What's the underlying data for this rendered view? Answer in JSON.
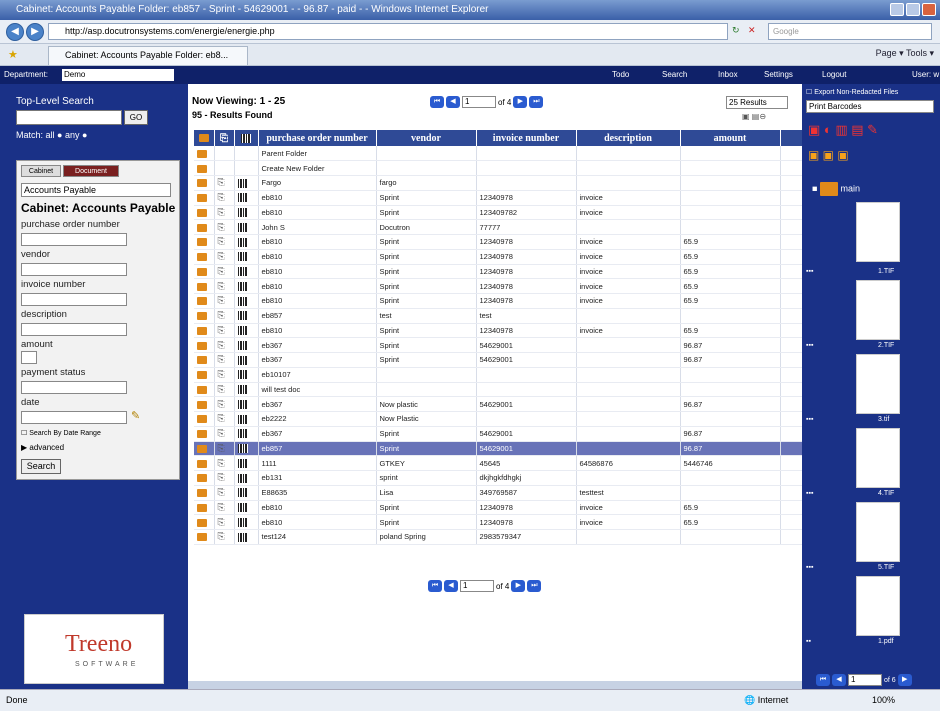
{
  "window": {
    "title": "Cabinet: Accounts Payable Folder: eb857 - Sprint - 54629001 - - 96.87 - paid - - Windows Internet Explorer"
  },
  "browser": {
    "url": "http://asp.docutronsystems.com/energie/energie.php",
    "search_placeholder": "Google",
    "tab_title": "Cabinet: Accounts Payable Folder: eb8...",
    "tools": "Page ▾  Tools ▾"
  },
  "appbar": {
    "department_label": "Department:",
    "department_value": "Demo",
    "nav": [
      "Todo",
      "Search",
      "Inbox",
      "Settings",
      "Logout",
      "User: w"
    ]
  },
  "sidebar": {
    "top_search_label": "Top-Level Search",
    "go": "GO",
    "match_label": "Match:",
    "match_all": "all",
    "match_any": "any",
    "tabs": [
      "Cabinet",
      "Document"
    ],
    "cabinet_select": "Accounts Payable",
    "cabinet_title": "Cabinet: Accounts Payable",
    "fields": [
      "purchase order number",
      "vendor",
      "invoice number",
      "description",
      "amount",
      "payment status",
      "date"
    ],
    "date_range": "Search By Date Range",
    "advanced": "advanced",
    "search_button": "Search",
    "logo_text": "Treeno",
    "logo_sub": "SOFTWARE"
  },
  "main": {
    "viewing": "Now Viewing: 1 - 25",
    "results": "95 - Results Found",
    "page_input": "1",
    "page_of": "of 4",
    "results_select": "25 Results",
    "columns": [
      "purchase order number",
      "vendor",
      "invoice number",
      "description",
      "amount"
    ],
    "rows": [
      {
        "po": "Parent Folder",
        "vendor": "",
        "inv": "",
        "desc": "",
        "amt": "",
        "kind": "parent"
      },
      {
        "po": "Create New Folder",
        "vendor": "",
        "inv": "",
        "desc": "",
        "amt": "",
        "kind": "new"
      },
      {
        "po": "Fargo",
        "vendor": "fargo",
        "inv": "",
        "desc": "",
        "amt": ""
      },
      {
        "po": "eb810",
        "vendor": "Sprint",
        "inv": "12340978",
        "desc": "invoice",
        "amt": ""
      },
      {
        "po": "eb810",
        "vendor": "Sprint",
        "inv": "123409782",
        "desc": "invoice",
        "amt": ""
      },
      {
        "po": "John S",
        "vendor": "Docutron",
        "inv": "77777",
        "desc": "",
        "amt": ""
      },
      {
        "po": "eb810",
        "vendor": "Sprint",
        "inv": "12340978",
        "desc": "invoice",
        "amt": "65.9"
      },
      {
        "po": "eb810",
        "vendor": "Sprint",
        "inv": "12340978",
        "desc": "invoice",
        "amt": "65.9"
      },
      {
        "po": "eb810",
        "vendor": "Sprint",
        "inv": "12340978",
        "desc": "invoice",
        "amt": "65.9"
      },
      {
        "po": "eb810",
        "vendor": "Sprint",
        "inv": "12340978",
        "desc": "invoice",
        "amt": "65.9"
      },
      {
        "po": "eb810",
        "vendor": "Sprint",
        "inv": "12340978",
        "desc": "invoice",
        "amt": "65.9"
      },
      {
        "po": "eb857",
        "vendor": "test",
        "inv": "test",
        "desc": "",
        "amt": ""
      },
      {
        "po": "eb810",
        "vendor": "Sprint",
        "inv": "12340978",
        "desc": "invoice",
        "amt": "65.9"
      },
      {
        "po": "eb367",
        "vendor": "Sprint",
        "inv": "54629001",
        "desc": "",
        "amt": "96.87"
      },
      {
        "po": "eb367",
        "vendor": "Sprint",
        "inv": "54629001",
        "desc": "",
        "amt": "96.87"
      },
      {
        "po": "eb10107",
        "vendor": "",
        "inv": "",
        "desc": "",
        "amt": ""
      },
      {
        "po": "will test doc",
        "vendor": "",
        "inv": "",
        "desc": "",
        "amt": ""
      },
      {
        "po": "eb367",
        "vendor": "Now plastic",
        "inv": "54629001",
        "desc": "",
        "amt": "96.87"
      },
      {
        "po": "eb2222",
        "vendor": "Now Plastic",
        "inv": "",
        "desc": "",
        "amt": ""
      },
      {
        "po": "eb367",
        "vendor": "Sprint",
        "inv": "54629001",
        "desc": "",
        "amt": "96.87"
      },
      {
        "po": "eb857",
        "vendor": "Sprint",
        "inv": "54629001",
        "desc": "",
        "amt": "96.87",
        "kind": "sel"
      },
      {
        "po": "1111",
        "vendor": "GTKEY",
        "inv": "45645",
        "desc": "64586876",
        "amt": "5446746"
      },
      {
        "po": "eb131",
        "vendor": "sprint",
        "inv": "dkjhgkfdhgkj",
        "desc": "",
        "amt": ""
      },
      {
        "po": "E88635",
        "vendor": "Lisa",
        "inv": "349769587",
        "desc": "testtest",
        "amt": ""
      },
      {
        "po": "eb810",
        "vendor": "Sprint",
        "inv": "12340978",
        "desc": "invoice",
        "amt": "65.9"
      },
      {
        "po": "eb810",
        "vendor": "Sprint",
        "inv": "12340978",
        "desc": "invoice",
        "amt": "65.9"
      },
      {
        "po": "test124",
        "vendor": "poland Spring",
        "inv": "2983579347",
        "desc": "",
        "amt": ""
      }
    ]
  },
  "right": {
    "export": "Export Non-Redacted Files",
    "print_select": "Print Barcodes",
    "folder": "main",
    "files": [
      "1.TIF",
      "2.TIF",
      "3.tif",
      "4.TIF",
      "5.TIF",
      "1.pdf"
    ],
    "page_input": "1",
    "page_of": "of 6"
  },
  "status": {
    "left": "Done",
    "zone": "Internet",
    "zoom": "100%"
  }
}
